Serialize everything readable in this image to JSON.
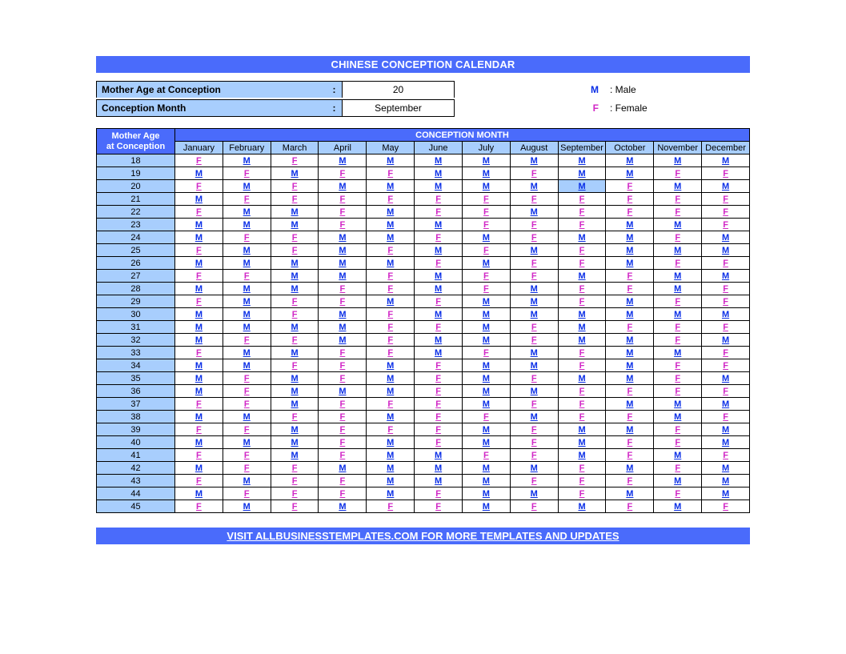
{
  "title": "CHINESE CONCEPTION CALENDAR",
  "inputs": {
    "age_label": "Mother Age at Conception",
    "age_value": "20",
    "month_label": "Conception Month",
    "month_value": "September",
    "colon": ":"
  },
  "legend": {
    "m_key": "M",
    "m_desc": ": Male",
    "f_key": "F",
    "f_desc": ": Female"
  },
  "footer": "VISIT ALLBUSINESSTEMPLATES.COM FOR MORE TEMPLATES AND UPDATES",
  "table": {
    "age_header_line1": "Mother Age",
    "age_header_line2": "at Conception",
    "cm_header": "CONCEPTION MONTH",
    "months": [
      "January",
      "February",
      "March",
      "April",
      "May",
      "June",
      "July",
      "August",
      "September",
      "October",
      "November",
      "December"
    ],
    "highlight_age": "20",
    "highlight_month_index": 8,
    "rows": [
      {
        "age": "18",
        "v": [
          "F",
          "M",
          "F",
          "M",
          "M",
          "M",
          "M",
          "M",
          "M",
          "M",
          "M",
          "M"
        ]
      },
      {
        "age": "19",
        "v": [
          "M",
          "F",
          "M",
          "F",
          "F",
          "M",
          "M",
          "F",
          "M",
          "M",
          "F",
          "F"
        ]
      },
      {
        "age": "20",
        "v": [
          "F",
          "M",
          "F",
          "M",
          "M",
          "M",
          "M",
          "M",
          "M",
          "F",
          "M",
          "M"
        ]
      },
      {
        "age": "21",
        "v": [
          "M",
          "F",
          "F",
          "F",
          "F",
          "F",
          "F",
          "F",
          "F",
          "F",
          "F",
          "F"
        ]
      },
      {
        "age": "22",
        "v": [
          "F",
          "M",
          "M",
          "F",
          "M",
          "F",
          "F",
          "M",
          "F",
          "F",
          "F",
          "F"
        ]
      },
      {
        "age": "23",
        "v": [
          "M",
          "M",
          "M",
          "F",
          "M",
          "M",
          "F",
          "F",
          "F",
          "M",
          "M",
          "F"
        ]
      },
      {
        "age": "24",
        "v": [
          "M",
          "F",
          "F",
          "M",
          "M",
          "F",
          "M",
          "F",
          "M",
          "M",
          "F",
          "M"
        ]
      },
      {
        "age": "25",
        "v": [
          "F",
          "M",
          "F",
          "M",
          "F",
          "M",
          "F",
          "M",
          "F",
          "M",
          "M",
          "M"
        ]
      },
      {
        "age": "26",
        "v": [
          "M",
          "M",
          "M",
          "M",
          "M",
          "F",
          "M",
          "F",
          "F",
          "M",
          "F",
          "F"
        ]
      },
      {
        "age": "27",
        "v": [
          "F",
          "F",
          "M",
          "M",
          "F",
          "M",
          "F",
          "F",
          "M",
          "F",
          "M",
          "M"
        ]
      },
      {
        "age": "28",
        "v": [
          "M",
          "M",
          "M",
          "F",
          "F",
          "M",
          "F",
          "M",
          "F",
          "F",
          "M",
          "F"
        ]
      },
      {
        "age": "29",
        "v": [
          "F",
          "M",
          "F",
          "F",
          "M",
          "F",
          "M",
          "M",
          "F",
          "M",
          "F",
          "F"
        ]
      },
      {
        "age": "30",
        "v": [
          "M",
          "M",
          "F",
          "M",
          "F",
          "M",
          "M",
          "M",
          "M",
          "M",
          "M",
          "M"
        ]
      },
      {
        "age": "31",
        "v": [
          "M",
          "M",
          "M",
          "M",
          "F",
          "F",
          "M",
          "F",
          "M",
          "F",
          "F",
          "F"
        ]
      },
      {
        "age": "32",
        "v": [
          "M",
          "F",
          "F",
          "M",
          "F",
          "M",
          "M",
          "F",
          "M",
          "M",
          "F",
          "M"
        ]
      },
      {
        "age": "33",
        "v": [
          "F",
          "M",
          "M",
          "F",
          "F",
          "M",
          "F",
          "M",
          "F",
          "M",
          "M",
          "F"
        ]
      },
      {
        "age": "34",
        "v": [
          "M",
          "M",
          "F",
          "F",
          "M",
          "F",
          "M",
          "M",
          "F",
          "M",
          "F",
          "F"
        ]
      },
      {
        "age": "35",
        "v": [
          "M",
          "F",
          "M",
          "F",
          "M",
          "F",
          "M",
          "F",
          "M",
          "M",
          "F",
          "M"
        ]
      },
      {
        "age": "36",
        "v": [
          "M",
          "F",
          "M",
          "M",
          "M",
          "F",
          "M",
          "M",
          "F",
          "F",
          "F",
          "F"
        ]
      },
      {
        "age": "37",
        "v": [
          "F",
          "F",
          "M",
          "F",
          "F",
          "F",
          "M",
          "F",
          "F",
          "M",
          "M",
          "M"
        ]
      },
      {
        "age": "38",
        "v": [
          "M",
          "M",
          "F",
          "F",
          "M",
          "F",
          "F",
          "M",
          "F",
          "F",
          "M",
          "F"
        ]
      },
      {
        "age": "39",
        "v": [
          "F",
          "F",
          "M",
          "F",
          "F",
          "F",
          "M",
          "F",
          "M",
          "M",
          "F",
          "M"
        ]
      },
      {
        "age": "40",
        "v": [
          "M",
          "M",
          "M",
          "F",
          "M",
          "F",
          "M",
          "F",
          "M",
          "F",
          "F",
          "M"
        ]
      },
      {
        "age": "41",
        "v": [
          "F",
          "F",
          "M",
          "F",
          "M",
          "M",
          "F",
          "F",
          "M",
          "F",
          "M",
          "F"
        ]
      },
      {
        "age": "42",
        "v": [
          "M",
          "F",
          "F",
          "M",
          "M",
          "M",
          "M",
          "M",
          "F",
          "M",
          "F",
          "M"
        ]
      },
      {
        "age": "43",
        "v": [
          "F",
          "M",
          "F",
          "F",
          "M",
          "M",
          "M",
          "F",
          "F",
          "F",
          "M",
          "M"
        ]
      },
      {
        "age": "44",
        "v": [
          "M",
          "F",
          "F",
          "F",
          "M",
          "F",
          "M",
          "M",
          "F",
          "M",
          "F",
          "M"
        ]
      },
      {
        "age": "45",
        "v": [
          "F",
          "M",
          "F",
          "M",
          "F",
          "F",
          "M",
          "F",
          "M",
          "F",
          "M",
          "F"
        ]
      }
    ]
  },
  "chart_data": {
    "type": "table",
    "title": "CHINESE CONCEPTION CALENDAR",
    "xlabel": "CONCEPTION MONTH",
    "ylabel": "Mother Age at Conception",
    "categories": [
      "January",
      "February",
      "March",
      "April",
      "May",
      "June",
      "July",
      "August",
      "September",
      "October",
      "November",
      "December"
    ],
    "rows": {
      "18": [
        "F",
        "M",
        "F",
        "M",
        "M",
        "M",
        "M",
        "M",
        "M",
        "M",
        "M",
        "M"
      ],
      "19": [
        "M",
        "F",
        "M",
        "F",
        "F",
        "M",
        "M",
        "F",
        "M",
        "M",
        "F",
        "F"
      ],
      "20": [
        "F",
        "M",
        "F",
        "M",
        "M",
        "M",
        "M",
        "M",
        "M",
        "F",
        "M",
        "M"
      ],
      "21": [
        "M",
        "F",
        "F",
        "F",
        "F",
        "F",
        "F",
        "F",
        "F",
        "F",
        "F",
        "F"
      ],
      "22": [
        "F",
        "M",
        "M",
        "F",
        "M",
        "F",
        "F",
        "M",
        "F",
        "F",
        "F",
        "F"
      ],
      "23": [
        "M",
        "M",
        "M",
        "F",
        "M",
        "M",
        "F",
        "F",
        "F",
        "M",
        "M",
        "F"
      ],
      "24": [
        "M",
        "F",
        "F",
        "M",
        "M",
        "F",
        "M",
        "F",
        "M",
        "M",
        "F",
        "M"
      ],
      "25": [
        "F",
        "M",
        "F",
        "M",
        "F",
        "M",
        "F",
        "M",
        "F",
        "M",
        "M",
        "M"
      ],
      "26": [
        "M",
        "M",
        "M",
        "M",
        "M",
        "F",
        "M",
        "F",
        "F",
        "M",
        "F",
        "F"
      ],
      "27": [
        "F",
        "F",
        "M",
        "M",
        "F",
        "M",
        "F",
        "F",
        "M",
        "F",
        "M",
        "M"
      ],
      "28": [
        "M",
        "M",
        "M",
        "F",
        "F",
        "M",
        "F",
        "M",
        "F",
        "F",
        "M",
        "F"
      ],
      "29": [
        "F",
        "M",
        "F",
        "F",
        "M",
        "F",
        "M",
        "M",
        "F",
        "M",
        "F",
        "F"
      ],
      "30": [
        "M",
        "M",
        "F",
        "M",
        "F",
        "M",
        "M",
        "M",
        "M",
        "M",
        "M",
        "M"
      ],
      "31": [
        "M",
        "M",
        "M",
        "M",
        "F",
        "F",
        "M",
        "F",
        "M",
        "F",
        "F",
        "F"
      ],
      "32": [
        "M",
        "F",
        "F",
        "M",
        "F",
        "M",
        "M",
        "F",
        "M",
        "M",
        "F",
        "M"
      ],
      "33": [
        "F",
        "M",
        "M",
        "F",
        "F",
        "M",
        "F",
        "M",
        "F",
        "M",
        "M",
        "F"
      ],
      "34": [
        "M",
        "M",
        "F",
        "F",
        "M",
        "F",
        "M",
        "M",
        "F",
        "M",
        "F",
        "F"
      ],
      "35": [
        "M",
        "F",
        "M",
        "F",
        "M",
        "F",
        "M",
        "F",
        "M",
        "M",
        "F",
        "M"
      ],
      "36": [
        "M",
        "F",
        "M",
        "M",
        "M",
        "F",
        "M",
        "M",
        "F",
        "F",
        "F",
        "F"
      ],
      "37": [
        "F",
        "F",
        "M",
        "F",
        "F",
        "F",
        "M",
        "F",
        "F",
        "M",
        "M",
        "M"
      ],
      "38": [
        "M",
        "M",
        "F",
        "F",
        "M",
        "F",
        "F",
        "M",
        "F",
        "F",
        "M",
        "F"
      ],
      "39": [
        "F",
        "F",
        "M",
        "F",
        "F",
        "F",
        "M",
        "F",
        "M",
        "M",
        "F",
        "M"
      ],
      "40": [
        "M",
        "M",
        "M",
        "F",
        "M",
        "F",
        "M",
        "F",
        "M",
        "F",
        "F",
        "M"
      ],
      "41": [
        "F",
        "F",
        "M",
        "F",
        "M",
        "M",
        "F",
        "F",
        "M",
        "F",
        "M",
        "F"
      ],
      "42": [
        "M",
        "F",
        "F",
        "M",
        "M",
        "M",
        "M",
        "M",
        "F",
        "M",
        "F",
        "M"
      ],
      "43": [
        "F",
        "M",
        "F",
        "F",
        "M",
        "M",
        "M",
        "F",
        "F",
        "F",
        "M",
        "M"
      ],
      "44": [
        "M",
        "F",
        "F",
        "F",
        "M",
        "F",
        "M",
        "M",
        "F",
        "M",
        "F",
        "M"
      ],
      "45": [
        "F",
        "M",
        "F",
        "M",
        "F",
        "F",
        "M",
        "F",
        "M",
        "F",
        "M",
        "F"
      ]
    },
    "legend": {
      "M": "Male",
      "F": "Female"
    }
  }
}
